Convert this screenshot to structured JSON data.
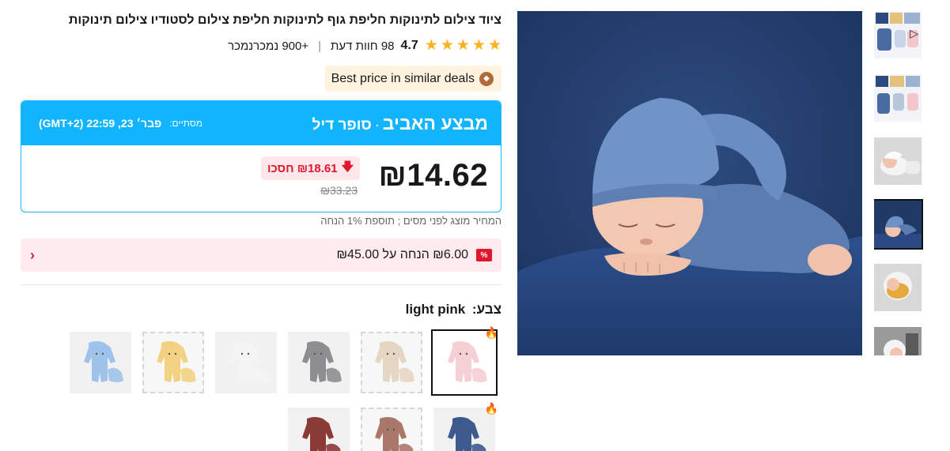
{
  "product": {
    "title": "ציוד צילום לתינוקות חליפת גוף לתינוקות חליפת צילום לסטודיו צילום תינוקות",
    "rating": "4.7",
    "reviews": "98 חוות דעת",
    "sold": "+900 נמכרנמכר",
    "best_price": "Best price in similar deals"
  },
  "deal": {
    "name_big": "מבצע האביב",
    "name_dot": "·",
    "name_small": "סופר דיל",
    "ends_label": "מסתיים:",
    "ends_time": "פבר׳ 23, 22:59 (GMT+2)",
    "price": "₪14.62",
    "save": "₪18.61 חסכו",
    "old_price": "₪33.23"
  },
  "tax_note": "המחיר מוצג לפני מסים ; תוספת 1% הנחה",
  "coupon": {
    "tag": "%",
    "text": "₪6.00 הנחה על ₪45.00"
  },
  "color": {
    "label": "צבע:",
    "value": "light pink"
  },
  "swatches": [
    {
      "name": "light-pink",
      "color": "#f4cfd4",
      "selected": true,
      "hot": true
    },
    {
      "name": "beige",
      "color": "#e4d6c2",
      "dashed": true
    },
    {
      "name": "grey",
      "color": "#8e8e90"
    },
    {
      "name": "white",
      "color": "#f4f4f4"
    },
    {
      "name": "yellow",
      "color": "#f2d282",
      "dashed": true
    },
    {
      "name": "light-blue",
      "color": "#9ec2ea"
    },
    {
      "name": "navy",
      "color": "#3c5a8e",
      "hot": true
    },
    {
      "name": "brown",
      "color": "#a9786a",
      "dashed": true
    },
    {
      "name": "burgundy",
      "color": "#8a3a37"
    }
  ],
  "icons": {
    "star": "star-icon",
    "play": "play-icon",
    "fire": "fire-icon",
    "chevron": "chevron-left-icon",
    "down_arrow": "arrow-down-icon"
  }
}
